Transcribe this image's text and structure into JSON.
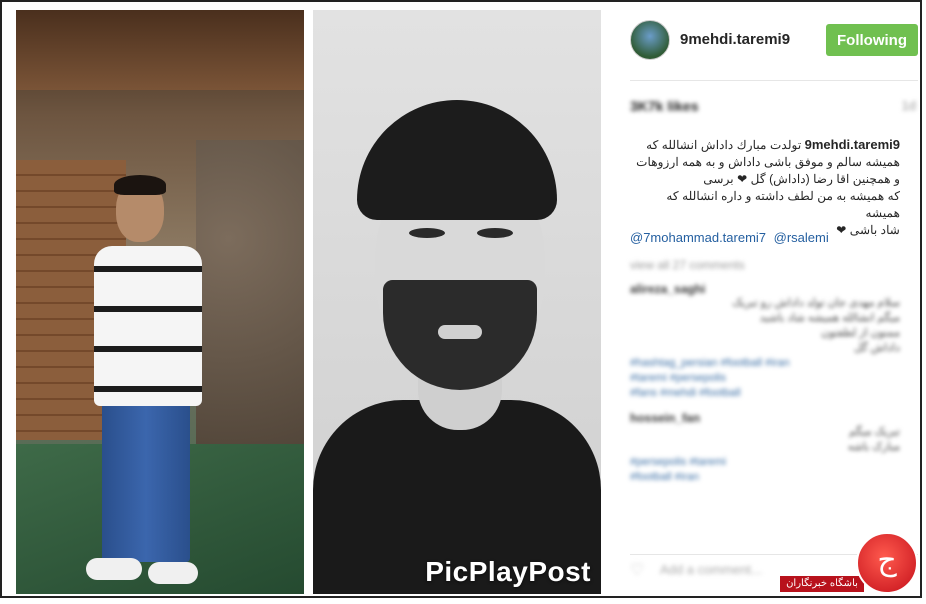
{
  "post": {
    "username": "9mehdi.taremi9",
    "follow_label": "Following",
    "likes": "3K7k likes",
    "time_ago": "1d",
    "caption_author": "9mehdi.taremi9",
    "caption_lines": [
      "تولدت مبارك داداش انشالله كه",
      "همیشه سالم و موفق باشی داداش و به همه ارزوهات",
      "و همچنین اقا رضا (داداش) گل ❤ برسی",
      "كه همیشه به من لطف داشته و داره انشالله كه همیشه",
      "شاد باشی ❤"
    ],
    "mentions": [
      "@7mohammad.taremi7",
      "@rsalemi"
    ],
    "view_all_comments": "view all 27 comments",
    "comments": [
      {
        "user": "alireza_saghi",
        "lines": [
          "سلام مهدی جان تولد داداش رو تبریک",
          "میگم انشالله همیشه شاد باشید",
          "ممنون از لطفتون",
          "داداش گل"
        ],
        "links": [
          "#hashtag_persian #football #iran",
          "#taremi #persepolis",
          "#fans #mehdi #football"
        ]
      },
      {
        "user": "hossein_fan",
        "lines": [
          "تبریک میگم",
          "مبارک باشه"
        ],
        "links": [
          "#persepolis #taremi",
          "#football #iran"
        ]
      }
    ],
    "add_comment_placeholder": "Add a comment..."
  },
  "media": {
    "watermark": "PicPlayPost"
  },
  "branding": {
    "logo_glyph": "ج",
    "site_label": "باشگاه خبرنگاران"
  },
  "colors": {
    "follow_button": "#70c050",
    "mention_link": "#245fa0",
    "logo_red": "#c4101a"
  }
}
